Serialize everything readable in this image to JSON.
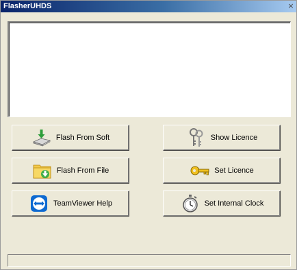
{
  "window": {
    "title": "FlasherUHDS",
    "close_glyph": "×"
  },
  "log": {
    "value": ""
  },
  "buttons": {
    "flash_from_soft": {
      "label": "Flash From Soft",
      "icon": "drive-download-icon"
    },
    "flash_from_file": {
      "label": "Flash From File",
      "icon": "folder-download-icon"
    },
    "teamviewer_help": {
      "label": "TeamViewer Help",
      "icon": "teamviewer-icon"
    },
    "show_licence": {
      "label": "Show Licence",
      "icon": "keys-icon"
    },
    "set_licence": {
      "label": "Set Licence",
      "icon": "key-icon"
    },
    "set_internal_clock": {
      "label": "Set Internal Clock",
      "icon": "stopwatch-icon"
    }
  },
  "status": {
    "text": ""
  },
  "colors": {
    "face": "#ece9d8",
    "title_start": "#0a246a",
    "title_end": "#a6caf0"
  }
}
